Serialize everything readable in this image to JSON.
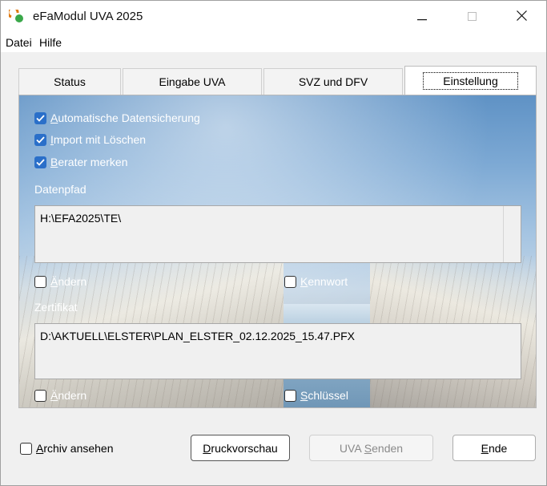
{
  "window": {
    "title": "eFaModul UVA 2025",
    "minimize_icon": "minimize-icon",
    "maximize_icon": "maximize-icon",
    "close_icon": "close-icon"
  },
  "menu": {
    "items": [
      "Datei",
      "Hilfe"
    ]
  },
  "tabs": [
    {
      "label": "Status",
      "active": false
    },
    {
      "label": "Eingabe UVA",
      "active": false
    },
    {
      "label": "SVZ und DFV",
      "active": false
    },
    {
      "label": "Einstellung",
      "active": true
    }
  ],
  "settings": {
    "options": [
      {
        "mnemonic": "A",
        "rest": "utomatische Datensicherung",
        "checked": true
      },
      {
        "mnemonic": "I",
        "rest": "mport mit Löschen",
        "checked": true
      },
      {
        "mnemonic": "B",
        "rest": "erater merken",
        "checked": true
      }
    ],
    "datenpfad": {
      "label": "Datenpfad",
      "value": "H:\\EFA2025\\TE\\",
      "aendern": {
        "mnemonic": "Ä",
        "rest": "ndern",
        "checked": false
      },
      "kennwort": {
        "mnemonic": "K",
        "rest": "ennwort",
        "checked": false
      }
    },
    "zertifikat": {
      "label": "Zertifikat",
      "value": "D:\\AKTUELL\\ELSTER\\PLAN_ELSTER_02.12.2025_15.47.PFX",
      "aendern": {
        "mnemonic": "Ä",
        "rest": "ndern",
        "checked": false
      },
      "schluessel": {
        "mnemonic": "S",
        "rest": "chlüssel",
        "checked": false
      }
    }
  },
  "footer": {
    "archiv": {
      "mnemonic": "A",
      "rest": "rchiv ansehen",
      "checked": false
    },
    "druckvorschau": {
      "mnemonic": "D",
      "rest": "ruckvorschau"
    },
    "uva_senden": {
      "prefix": "UVA ",
      "mnemonic": "S",
      "rest": "enden",
      "enabled": false
    },
    "ende": {
      "mnemonic": "E",
      "rest": "nde"
    }
  },
  "colors": {
    "checkbox_blue": "#2a6fc9",
    "sky_blue": "#7da9d4"
  }
}
